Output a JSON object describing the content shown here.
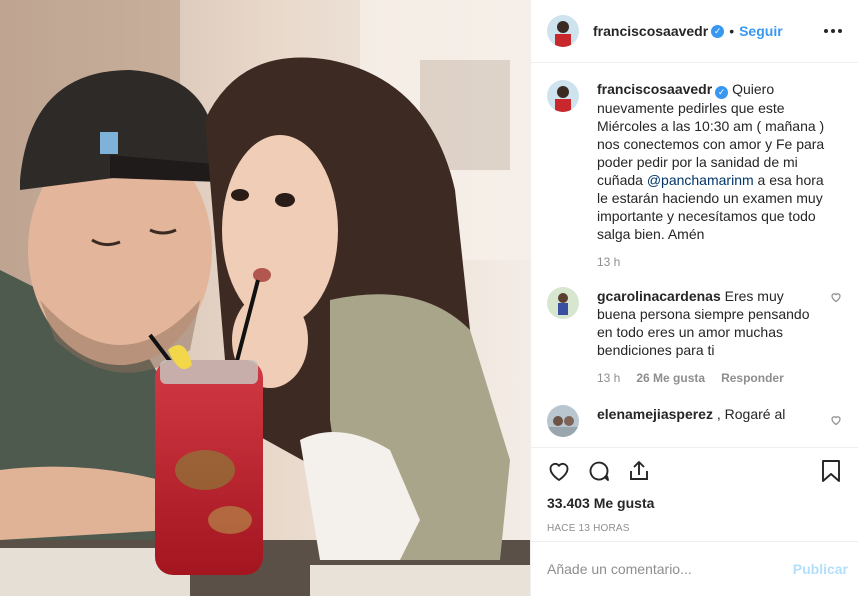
{
  "post": {
    "author": "franciscosaavedr",
    "verified_badge": "verified-icon",
    "separator": "•",
    "follow_label": "Seguir",
    "caption_author": "franciscosaavedr",
    "caption_pre": "Quiero nuevamente pedirles que este Miércoles a las 10:30 am ( mañana ) nos conectemos con amor y Fe para poder pedir por la sanidad de mi cuñada ",
    "caption_mention": "@panchamarinm",
    "caption_post": " a esa hora le estarán haciendo un examen muy importante y necesítamos que todo salga bien. Amén",
    "caption_time": "13 h",
    "likes": "33.403 Me gusta",
    "timestamp": "HACE 13 HORAS"
  },
  "comments": [
    {
      "user": "gcarolinacardenas",
      "text": "Eres muy buena persona siempre pensando en todo eres un amor muchas bendiciones para ti",
      "time": "13 h",
      "likes": "26 Me gusta",
      "reply": "Responder"
    },
    {
      "user": "elenamejiasperez",
      "text": ", Rogaré al",
      "time": "",
      "likes": "",
      "reply": ""
    }
  ],
  "add_comment": {
    "placeholder": "Añade un comentario...",
    "publish_label": "Publicar"
  },
  "colors": {
    "accent": "#3897f0",
    "text": "#262626",
    "muted": "#8e8e8e",
    "publish_disabled": "#b2dffc"
  },
  "icons": [
    "heart-icon",
    "comment-icon",
    "share-icon",
    "bookmark-icon",
    "more-icon",
    "verified-icon",
    "like-comment-icon"
  ]
}
